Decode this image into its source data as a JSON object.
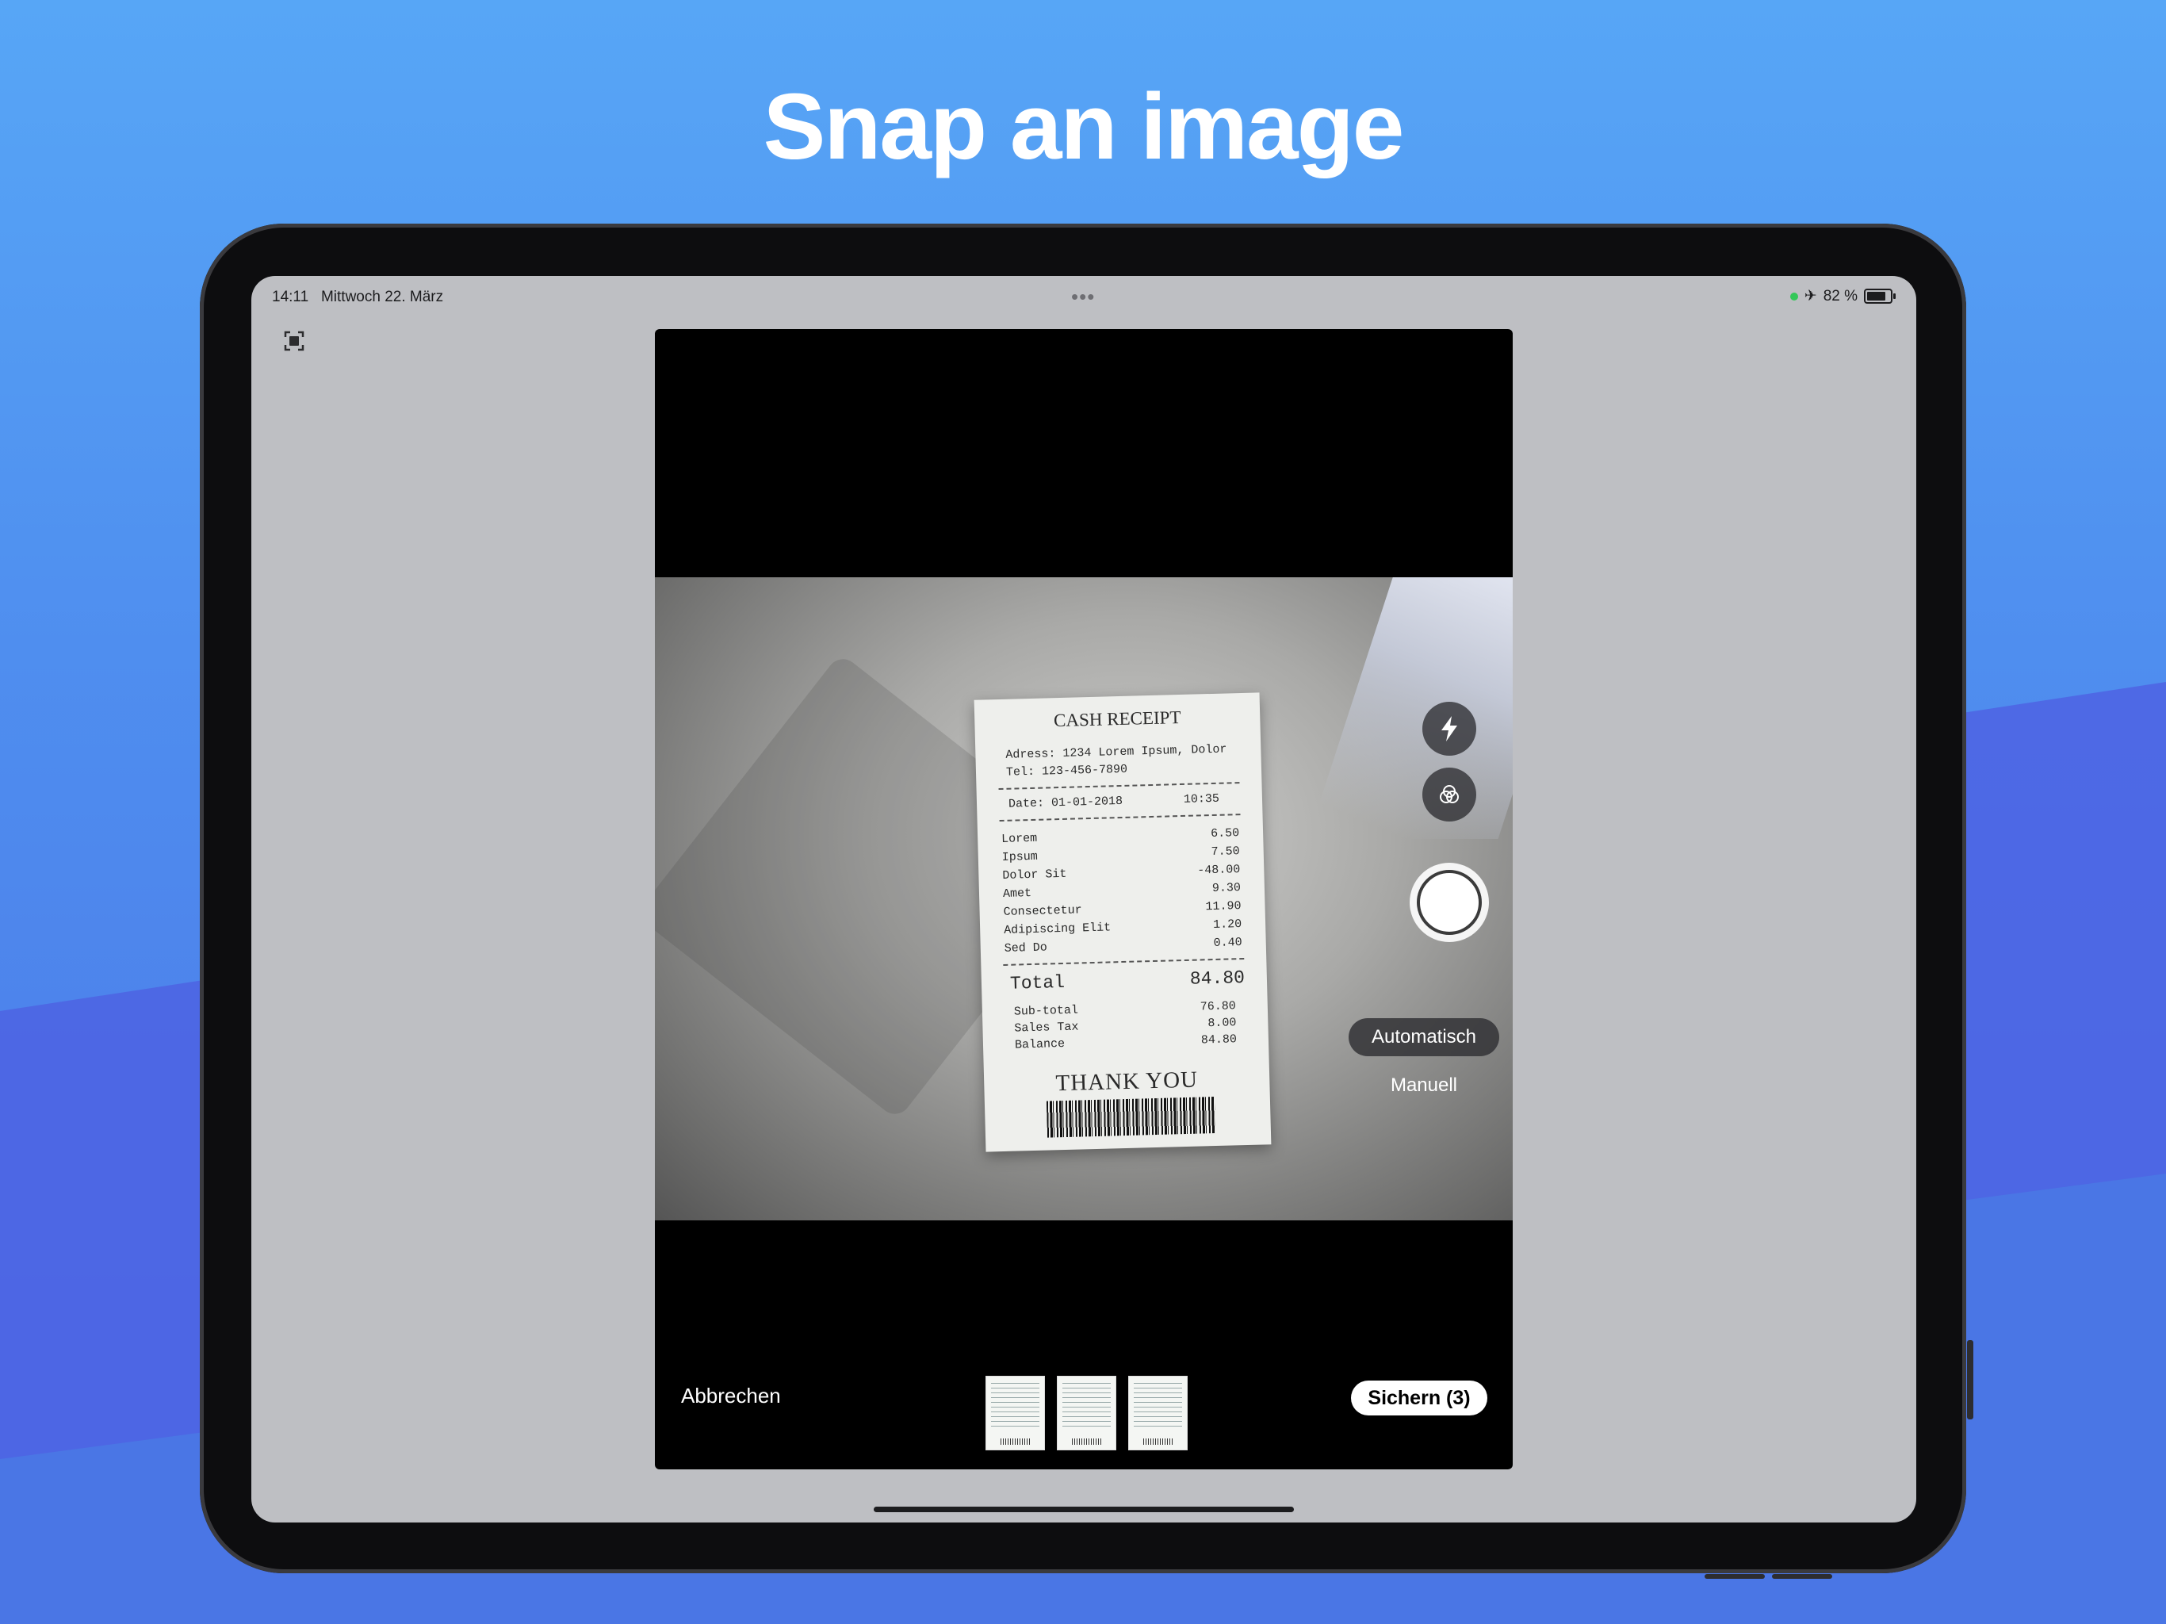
{
  "headline": "Snap an image",
  "status_bar": {
    "time": "14:11",
    "date": "Mittwoch 22. März",
    "multitask_dots": "•••",
    "airplane_icon": "✈",
    "battery_percent": "82 %"
  },
  "receipt": {
    "title": "CASH RECEIPT",
    "address": "Adress: 1234 Lorem Ipsum, Dolor",
    "tel": "Tel: 123-456-7890",
    "date": "Date: 01-01-2018",
    "time": "10:35",
    "items": [
      {
        "name": "Lorem",
        "amount": "6.50"
      },
      {
        "name": "Ipsum",
        "amount": "7.50"
      },
      {
        "name": "Dolor Sit",
        "amount": "-48.00"
      },
      {
        "name": "Amet",
        "amount": "9.30"
      },
      {
        "name": "Consectetur",
        "amount": "11.90"
      },
      {
        "name": "Adipiscing Elit",
        "amount": "1.20"
      },
      {
        "name": "Sed Do",
        "amount": "0.40"
      }
    ],
    "total_label": "Total",
    "total_value": "84.80",
    "summary": [
      {
        "name": "Sub-total",
        "amount": "76.80"
      },
      {
        "name": "Sales Tax",
        "amount": "8.00"
      },
      {
        "name": "Balance",
        "amount": "84.80"
      }
    ],
    "thanks": "THANK YOU"
  },
  "camera": {
    "mode_auto": "Automatisch",
    "mode_manual": "Manuell",
    "cancel": "Abbrechen",
    "save": "Sichern (3)",
    "thumbnail_count": 3
  }
}
